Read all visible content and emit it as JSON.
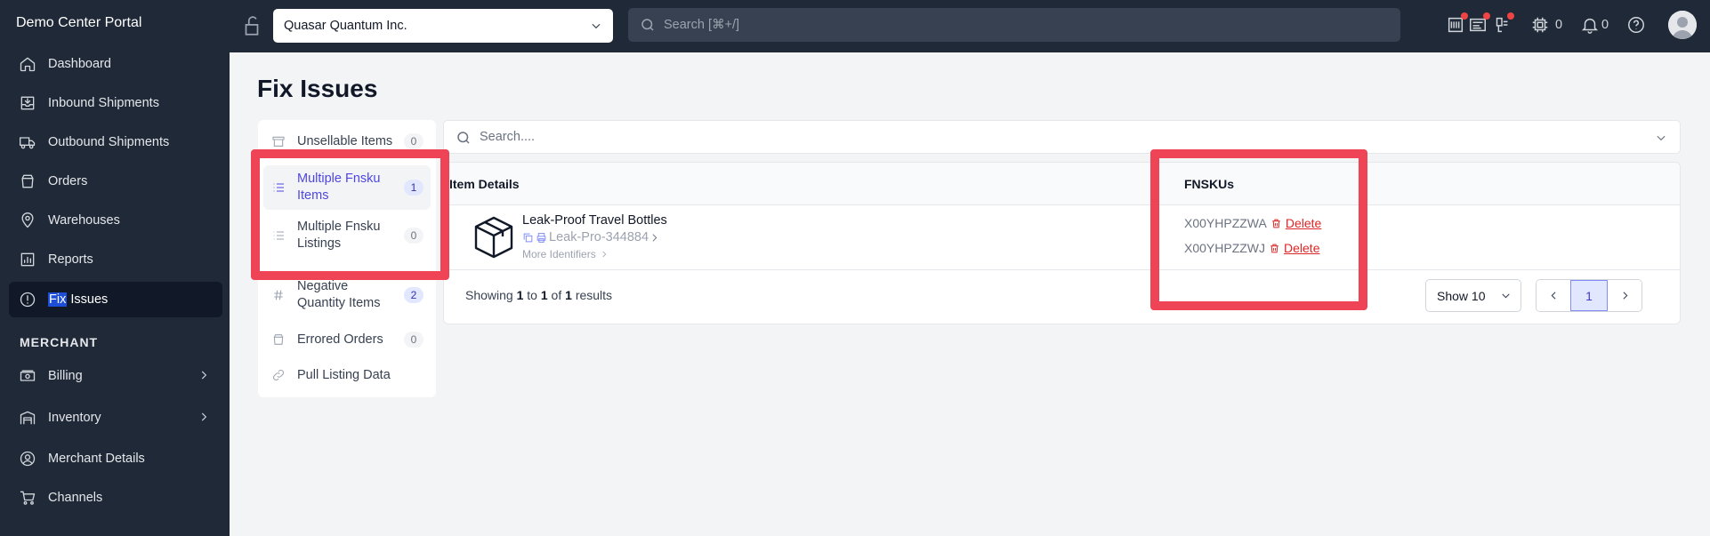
{
  "brand": "Demo Center Portal",
  "sidebar": {
    "items": [
      {
        "label": "Dashboard",
        "icon": "home-icon"
      },
      {
        "label": "Inbound Shipments",
        "icon": "inbox-icon"
      },
      {
        "label": "Outbound Shipments",
        "icon": "truck-icon"
      },
      {
        "label": "Orders",
        "icon": "bag-icon"
      },
      {
        "label": "Warehouses",
        "icon": "location-pin-icon"
      },
      {
        "label": "Reports",
        "icon": "bar-chart-icon"
      },
      {
        "label_highlight": "Fix",
        "label_rest": " Issues",
        "icon": "alert-circle-icon",
        "active": true
      }
    ],
    "section_label": "MERCHANT",
    "merchant_items": [
      {
        "label": "Billing",
        "icon": "money-icon",
        "has_chevron": true
      },
      {
        "label": "Inventory",
        "icon": "warehouse-icon",
        "has_chevron": true
      },
      {
        "label": "Merchant Details",
        "icon": "user-circle-icon"
      },
      {
        "label": "Channels",
        "icon": "cart-icon"
      }
    ]
  },
  "topbar": {
    "company": "Quasar Quantum Inc.",
    "search_placeholder": "Search [⌘+/]",
    "cube_count": "0",
    "bell_count": "0"
  },
  "page": {
    "title": "Fix Issues",
    "filters": [
      {
        "label": "Unsellable Items",
        "count": "0"
      },
      {
        "label": "Multiple Fnsku Items",
        "count": "1",
        "selected": true
      },
      {
        "label": "Multiple Fnsku Listings",
        "count": "0"
      },
      {
        "label": "Negative Quantity Items",
        "count": "2"
      },
      {
        "label": "Errored Orders",
        "count": "0"
      },
      {
        "label": "Pull Listing Data",
        "count": ""
      }
    ],
    "search_placeholder": "Search....",
    "table": {
      "headers": [
        "Item Details",
        "FNSKUs"
      ],
      "rows": [
        {
          "name": "Leak-Proof Travel Bottles",
          "sku": "Leak-Pro-344884",
          "more": "More Identifiers",
          "fnskus": [
            {
              "code": "X00YHPZZWA",
              "action": "Delete"
            },
            {
              "code": "X00YHPZZWJ",
              "action": "Delete"
            }
          ]
        }
      ]
    },
    "showing_prefix": "Showing",
    "showing_from": "1",
    "showing_to_word": "to",
    "showing_to": "1",
    "showing_of_word": "of",
    "showing_total": "1",
    "showing_suffix": "results",
    "page_size": "Show 10",
    "current_page": "1"
  },
  "colors": {
    "sidebar_bg": "#1f2937",
    "accent": "#4f46e5",
    "danger": "#dc2626",
    "annotation": "#ef4456"
  }
}
